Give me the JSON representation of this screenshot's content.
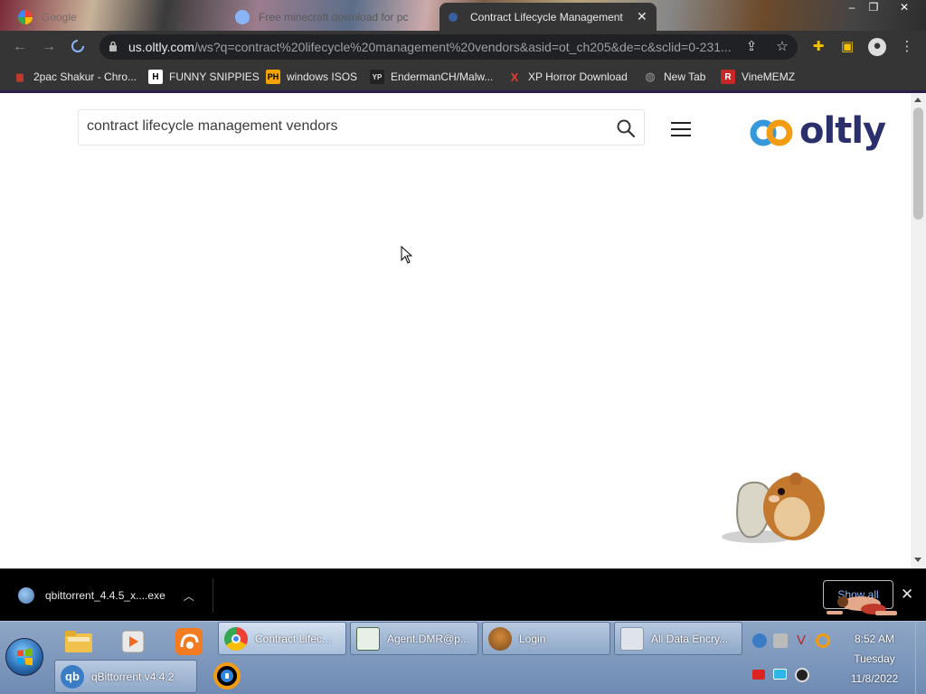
{
  "browser": {
    "tabs": [
      {
        "title": "Google",
        "active": false
      },
      {
        "title": "Free minecraft download for pc",
        "active": false
      },
      {
        "title": "Contract Lifecycle Management",
        "active": true
      }
    ],
    "url_domain": "us.oltly.com",
    "url_path": "/ws?q=contract%20lifecycle%20management%20vendors&asid=ot_ch205&de=c&sclid=0-231...",
    "bookmarks": [
      {
        "label": "2pac Shakur - Chro...",
        "icon": "film-icon",
        "color": "#c0392b"
      },
      {
        "label": "FUNNY SNIPPIES",
        "icon": "H",
        "color": "#ffffff"
      },
      {
        "label": "windows ISOS",
        "icon": "PH",
        "color": "#f5a300"
      },
      {
        "label": "EndermanCH/Malw...",
        "icon": "YP",
        "color": "#333333"
      },
      {
        "label": "XP Horror Download",
        "icon": "X",
        "color": "#e53935"
      },
      {
        "label": "New Tab",
        "icon": "globe-icon",
        "color": "#777777"
      },
      {
        "label": "VineMEMZ",
        "icon": "R",
        "color": "#c62828"
      }
    ]
  },
  "page": {
    "search_value": "contract lifecycle management vendors",
    "logo_text": "oltly"
  },
  "download_shelf": {
    "file_name": "qbittorrent_4.4.5_x....exe",
    "show_all_label": "Show all"
  },
  "taskbar": {
    "tasks_row1": [
      {
        "label": "Contract Lifec...",
        "active": true
      },
      {
        "label": "Agent.DMR@p...",
        "active": false
      },
      {
        "label": "Login",
        "active": false
      },
      {
        "label": "All Data Encry...",
        "active": false
      }
    ],
    "tasks_row2": [
      {
        "label": "qBittorrent v4.4.2",
        "active": false
      }
    ],
    "clock": {
      "time": "8:52 AM",
      "day": "Tuesday",
      "date": "11/8/2022"
    }
  },
  "colors": {
    "browser_chrome": "#353535",
    "logo_navy": "#2b2f6b",
    "logo_orange": "#f39c12",
    "logo_blue": "#3498db",
    "link_blue": "#8ab4f8"
  }
}
